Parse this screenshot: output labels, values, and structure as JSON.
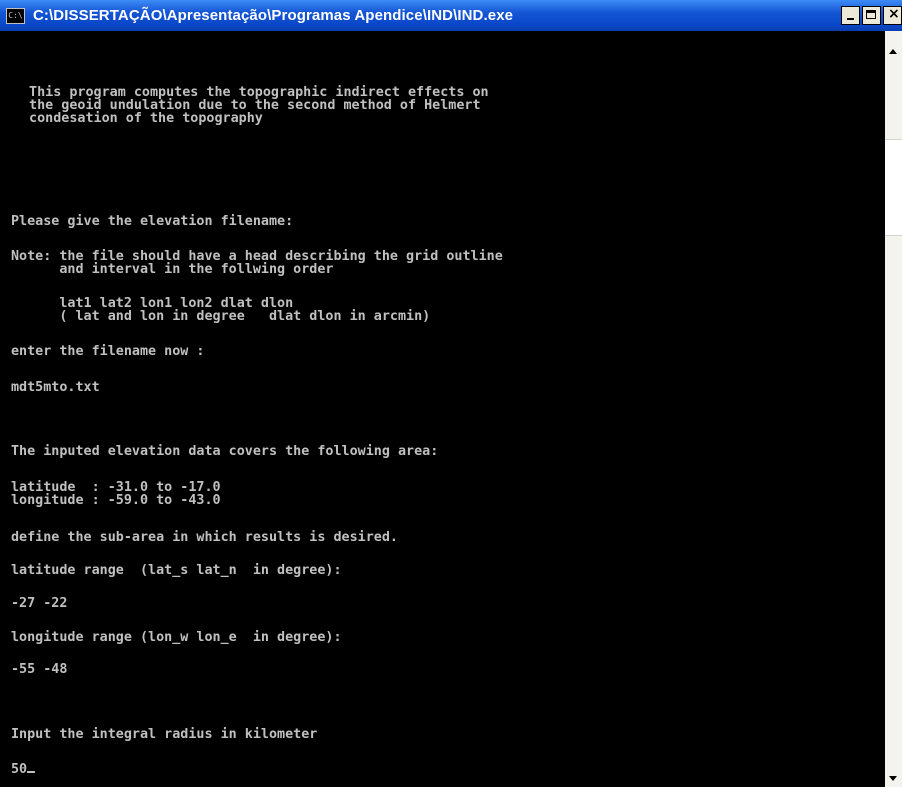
{
  "window": {
    "title": "C:\\DISSERTAÇÃO\\Apresentação\\Programas Apendice\\IND\\IND.exe",
    "icon": "console-icon",
    "icon_text": "C:\\"
  },
  "console": {
    "lines": [
      " This program computes the topographic indirect effects on",
      " the geoid undulation due to the second method of Helmert",
      " condesation of the topography",
      "Please give the elevation filename:",
      "Note: the file should have a head describing the grid outline",
      "      and interval in the follwing order",
      "      lat1 lat2 lon1 lon2 dlat dlon",
      "      ( lat and lon in degree   dlat dlon in arcmin)",
      "enter the filename now :",
      "mdt5mto.txt",
      "The inputed elevation data covers the following area:",
      "latitude  : -31.0 to -17.0",
      "longitude : -59.0 to -43.0",
      "define the sub-area in which results is desired.",
      "latitude range  (lat_s lat_n  in degree):",
      "-27 -22",
      "longitude range (lon_w lon_e  in degree):",
      "-55 -48",
      "Input the integral radius in kilometer",
      "50"
    ]
  }
}
